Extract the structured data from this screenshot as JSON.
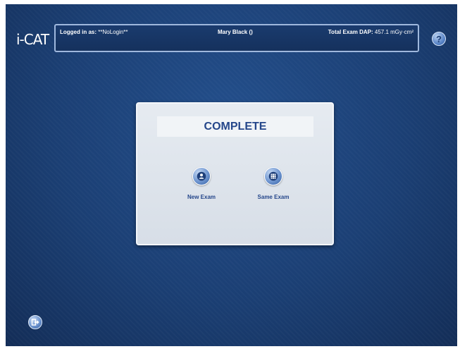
{
  "app": {
    "logo": "i-CAT"
  },
  "header": {
    "login_label": "Logged in as:",
    "login_value": "**NoLogin**",
    "patient": "Mary Black ()",
    "dap_label": "Total Exam DAP:",
    "dap_value": "457.1 mGy·cm²"
  },
  "help": {
    "label": "?"
  },
  "dialog": {
    "title": "COMPLETE",
    "actions": [
      {
        "label": "New Exam",
        "icon": "person-icon"
      },
      {
        "label": "Same Exam",
        "icon": "grid-icon"
      }
    ]
  },
  "exit": {
    "icon": "exit-icon"
  },
  "colors": {
    "background": "#1b3f74",
    "accent": "#24468a",
    "dialog_bg": "#dde3ea"
  }
}
